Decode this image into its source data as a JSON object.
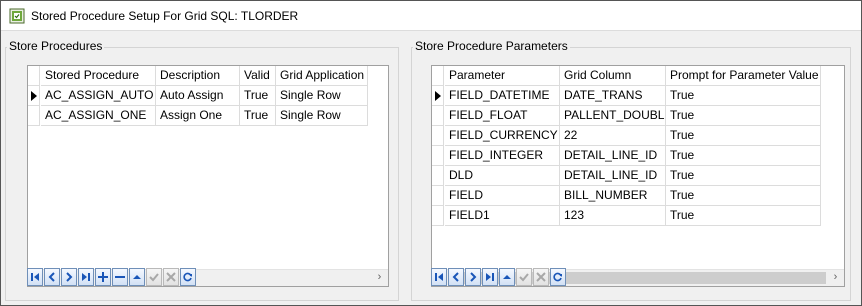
{
  "window": {
    "title": "Stored Procedure Setup For Grid SQL: TLORDER"
  },
  "left_panel": {
    "title": "Store Procedures",
    "columns": [
      "Stored Procedure",
      "Description",
      "Valid",
      "Grid Application"
    ],
    "rows": [
      [
        "AC_ASSIGN_AUTO",
        "Auto Assign",
        "True",
        "Single Row"
      ],
      [
        "AC_ASSIGN_ONE",
        "Assign One",
        "True",
        "Single Row"
      ]
    ],
    "current_row": 0,
    "navigator": [
      "first-icon",
      "prior-icon",
      "next-icon",
      "last-icon",
      "insert-icon",
      "delete-icon",
      "edit-icon",
      "post-icon",
      "cancel-icon",
      "refresh-icon"
    ]
  },
  "right_panel": {
    "title": "Store Procedure Parameters",
    "columns": [
      "Parameter",
      "Grid Column",
      "Prompt for Parameter Value"
    ],
    "rows": [
      [
        "FIELD_DATETIME",
        "DATE_TRANS",
        "True"
      ],
      [
        "FIELD_FLOAT",
        "PALLENT_DOUBLE",
        "True"
      ],
      [
        "FIELD_CURRENCY",
        "22",
        "True"
      ],
      [
        "FIELD_INTEGER",
        "DETAIL_LINE_ID",
        "True"
      ],
      [
        "DLD",
        "DETAIL_LINE_ID",
        "True"
      ],
      [
        "FIELD",
        "BILL_NUMBER",
        "True"
      ],
      [
        "FIELD1",
        "123",
        "True"
      ]
    ],
    "current_row": 0,
    "navigator": [
      "first-icon",
      "prior-icon",
      "next-icon",
      "last-icon",
      "edit-icon",
      "post-icon",
      "cancel-icon",
      "refresh-icon"
    ]
  },
  "colors": {
    "nav_blue": "#1a56b8",
    "nav_disabled": "#a8a8a8"
  }
}
